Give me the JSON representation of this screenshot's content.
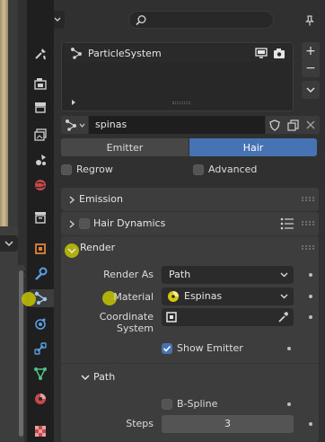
{
  "header": {
    "search_placeholder": ""
  },
  "tabs": [
    {
      "name": "tool-tab-icon"
    },
    {
      "name": "render-tab-icon"
    },
    {
      "name": "output-tab-icon"
    },
    {
      "name": "view-layer-tab-icon"
    },
    {
      "name": "scene-tab-icon"
    },
    {
      "name": "world-tab-icon"
    },
    {
      "name": "collection-tab-icon"
    },
    {
      "name": "object-tab-icon"
    },
    {
      "name": "modifier-tab-icon"
    },
    {
      "name": "particles-tab-icon"
    },
    {
      "name": "physics-tab-icon"
    },
    {
      "name": "constraints-tab-icon"
    },
    {
      "name": "data-tab-icon"
    },
    {
      "name": "material-tab-icon"
    },
    {
      "name": "texture-tab-icon"
    }
  ],
  "particle_list": {
    "items": [
      {
        "name": "ParticleSystem"
      }
    ]
  },
  "settings": {
    "name": "spinas"
  },
  "mode_toggle": {
    "emitter": "Emitter",
    "hair": "Hair",
    "selected": "Hair"
  },
  "options": {
    "regrow": "Regrow",
    "advanced": "Advanced"
  },
  "panels": {
    "emission": "Emission",
    "hair_dynamics": "Hair Dynamics",
    "render": "Render"
  },
  "render": {
    "render_as_label": "Render As",
    "render_as_value": "Path",
    "material_label": "Material",
    "material_value": "Espinas",
    "coordinate_system_label": "Coordinate System",
    "show_emitter_label": "Show Emitter",
    "show_emitter": true
  },
  "path": {
    "title": "Path",
    "bspline_label": "B-Spline",
    "steps_label": "Steps",
    "steps_value": "3"
  },
  "colors": {
    "accent": "#4772b3",
    "highlight": "#c4c400",
    "panel": "#3d3d3d",
    "background": "#303030"
  }
}
